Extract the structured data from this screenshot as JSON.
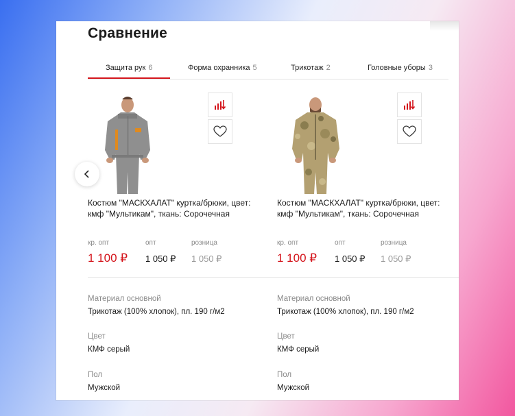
{
  "page": {
    "title": "Сравнение"
  },
  "tabs": [
    {
      "label": "Защита рук",
      "count": "6"
    },
    {
      "label": "Форма охранника",
      "count": "5"
    },
    {
      "label": "Трикотаж",
      "count": "2"
    },
    {
      "label": "Головные уборы",
      "count": "3"
    }
  ],
  "colors": {
    "accent": "#d4141b"
  },
  "products": [
    {
      "name": "Костюм \"МАСКХАЛАТ\" куртка/брюки, цвет: кмф \"Мультикам\", ткань: Сорочечная",
      "price_labels": [
        "кр. опт",
        "опт",
        "розница"
      ],
      "prices": [
        "1 100 ₽",
        "1 050 ₽",
        "1 050 ₽"
      ]
    },
    {
      "name": "Костюм \"МАСКХАЛАТ\" куртка/брюки, цвет: кмф \"Мультикам\", ткань: Сорочечная",
      "price_labels": [
        "кр. опт",
        "опт",
        "розница"
      ],
      "prices": [
        "1 100 ₽",
        "1 050 ₽",
        "1 050 ₽"
      ]
    }
  ],
  "attributes": [
    {
      "label": "Материал основной",
      "values": [
        "Трикотаж (100% хлопок), пл. 190 г/м2",
        "Трикотаж (100% хлопок), пл. 190 г/м2"
      ]
    },
    {
      "label": "Цвет",
      "values": [
        "КМФ серый",
        "КМФ серый"
      ]
    },
    {
      "label": "Пол",
      "values": [
        "Мужской",
        "Мужской"
      ]
    }
  ]
}
